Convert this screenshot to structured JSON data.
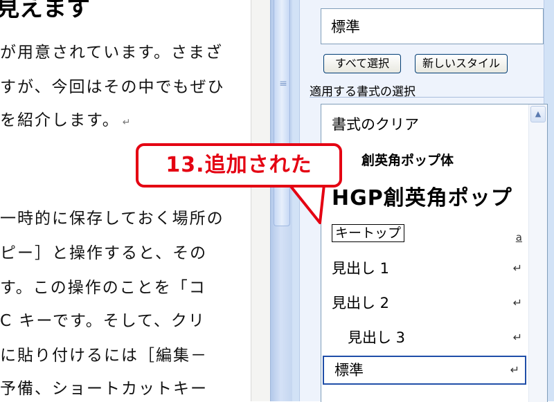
{
  "document": {
    "heading": "見えます",
    "heading_mark": "↵",
    "paragraphs": [
      [
        "が用意されています。さまざ",
        "すが、今回はその中でもぜひ",
        "を紹介します。"
      ],
      [
        "一時的に保存しておく場所の",
        "ピー］と操作すると、その",
        "す。この操作のことを「コ",
        "C キーです。そして、クリ",
        "に貼り付けるには［編集－",
        "予備、ショートカットキー"
      ]
    ],
    "return_mark": "↵"
  },
  "styles_pane": {
    "current_style": "標準",
    "select_all_button": "すべて選択",
    "new_style_button": "新しいスタイル",
    "apply_label": "適用する書式の選択",
    "items": [
      {
        "label": "書式のクリア",
        "indicator": ""
      },
      {
        "label": "創英角ポップ体",
        "indicator": ""
      },
      {
        "label": "HGP創英角ポップ",
        "indicator": ""
      },
      {
        "label": "キートップ",
        "indicator": "a"
      },
      {
        "label": "見出し 1",
        "indicator": "↵"
      },
      {
        "label": "見出し 2",
        "indicator": "↵"
      },
      {
        "label": "見出し 3",
        "indicator": "↵"
      },
      {
        "label": "標準",
        "indicator": "↵"
      }
    ],
    "scroll_up_icon": "▲"
  },
  "callout": {
    "text": "13.追加された",
    "color": "#e40012"
  },
  "colors": {
    "pane_background": "#eef3fc",
    "selection_border": "#1f4ea8",
    "scrollbar": "#c4d6f0"
  }
}
